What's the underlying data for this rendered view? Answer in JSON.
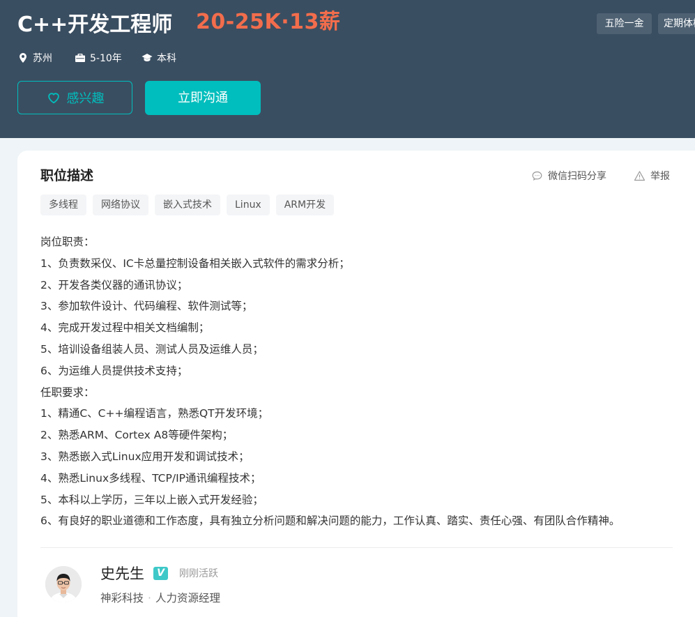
{
  "job": {
    "title": "C++开发工程师",
    "salary": "20-25K·13薪",
    "welfare": [
      "五险一金",
      "定期体检"
    ],
    "meta": [
      {
        "icon": "location-icon",
        "text": "苏州"
      },
      {
        "icon": "briefcase-icon",
        "text": "5-10年"
      },
      {
        "icon": "graduation-cap-icon",
        "text": "本科"
      }
    ],
    "buttons": {
      "interest": "感兴趣",
      "chat": "立即沟通"
    }
  },
  "detail": {
    "title": "职位描述",
    "share": "微信扫码分享",
    "report": "举报",
    "tags": [
      "多线程",
      "网络协议",
      "嵌入式技术",
      "Linux",
      "ARM开发"
    ],
    "lines": [
      "岗位职责：",
      "1、负责数采仪、IC卡总量控制设备相关嵌入式软件的需求分析；",
      "2、开发各类仪器的通讯协议；",
      "3、参加软件设计、代码编程、软件测试等；",
      "4、完成开发过程中相关文档编制；",
      "5、培训设备组装人员、测试人员及运维人员；",
      "6、为运维人员提供技术支持；",
      "任职要求：",
      "1、精通C、C++编程语言，熟悉QT开发环境；",
      "2、熟悉ARM、Cortex A8等硬件架构；",
      "3、熟悉嵌入式Linux应用开发和调试技术；",
      "4、熟悉Linux多线程、TCP/IP通讯编程技术；",
      "5、本科以上学历，三年以上嵌入式开发经验；",
      "6、有良好的职业道德和工作态度，具有独立分析问题和解决问题的能力，工作认真、踏实、责任心强、有团队合作精神。"
    ]
  },
  "recruiter": {
    "name": "史先生",
    "badge": "V",
    "status": "刚刚活跃",
    "company": "神彩科技",
    "position": "人力资源经理"
  },
  "colors": {
    "banner": "#3a4e61",
    "accent": "#00bebd",
    "salary": "#f26d4c"
  }
}
